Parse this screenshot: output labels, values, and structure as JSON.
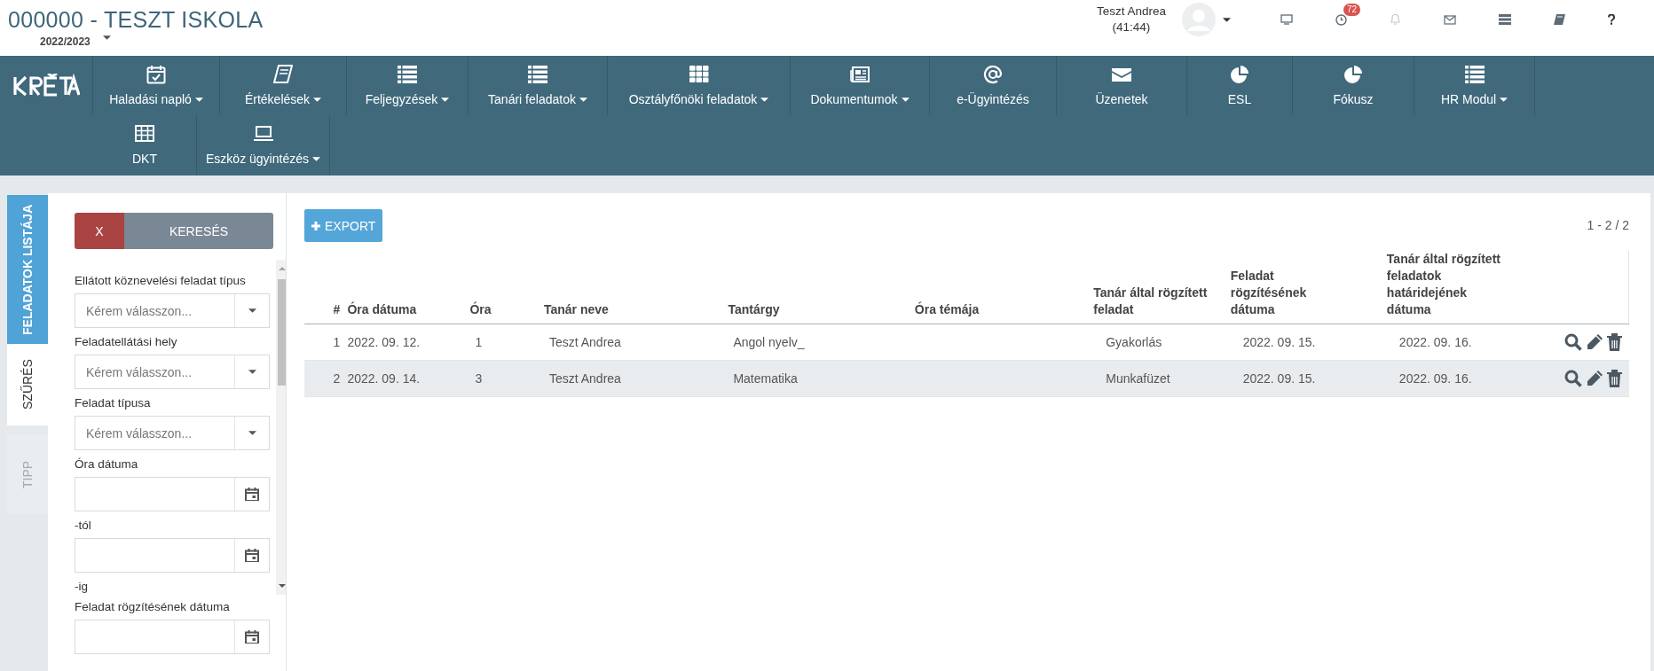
{
  "header": {
    "title": "000000 - TESZT ISKOLA",
    "school_year": "2022/2023",
    "user_name": "Teszt Andrea",
    "session_time": "(41:44)",
    "notification_count": "72"
  },
  "nav": {
    "items": [
      {
        "label": "Haladási napló",
        "has_menu": true
      },
      {
        "label": "Értékelések",
        "has_menu": true
      },
      {
        "label": "Feljegyzések",
        "has_menu": true
      },
      {
        "label": "Tanári feladatok",
        "has_menu": true
      },
      {
        "label": "Osztályfőnöki feladatok",
        "has_menu": true
      },
      {
        "label": "Dokumentumok",
        "has_menu": true
      },
      {
        "label": "e-Ügyintézés",
        "has_menu": false
      },
      {
        "label": "Üzenetek",
        "has_menu": false
      },
      {
        "label": "ESL",
        "has_menu": false
      },
      {
        "label": "Fókusz",
        "has_menu": false
      },
      {
        "label": "HR Modul",
        "has_menu": true
      },
      {
        "label": "DKT",
        "has_menu": false
      },
      {
        "label": "Eszköz ügyintézés",
        "has_menu": true
      }
    ]
  },
  "side_tabs": [
    {
      "label": "FELADATOK LISTÁJA",
      "kind": "accent",
      "selected": false,
      "disabled": false
    },
    {
      "label": "SZŰRÉS",
      "kind": "plain",
      "selected": true,
      "disabled": false
    },
    {
      "label": "TIPP",
      "kind": "plain",
      "selected": false,
      "disabled": true
    }
  ],
  "filter": {
    "clear_button": "X",
    "search_button": "KERESÉS",
    "fields": [
      {
        "kind": "select",
        "label": "Ellátott köznevelési feladat típus",
        "placeholder": "Kérem válasszon..."
      },
      {
        "kind": "select",
        "label": "Feladatellátási hely",
        "placeholder": "Kérem válasszon..."
      },
      {
        "kind": "select",
        "label": "Feladat típusa",
        "placeholder": "Kérem válasszon..."
      },
      {
        "kind": "date",
        "label": "Óra dátuma"
      },
      {
        "kind": "date",
        "label": "-tól"
      },
      {
        "kind": "note",
        "label": "-ig"
      },
      {
        "kind": "date",
        "label": "Feladat rögzítésének dátuma"
      }
    ]
  },
  "main": {
    "export_button": "EXPORT",
    "pager": "1 - 2 / 2",
    "table": {
      "columns": [
        "#",
        "Óra dátuma",
        "Óra",
        "Tanár neve",
        "Tantárgy",
        "Óra témája",
        "Tanár által rögzített feladat",
        "Feladat rögzítésének dátuma",
        "Tanár által rögzített feladatok határidejének dátuma"
      ],
      "rows": [
        {
          "cells": [
            "1",
            "2022. 09. 12.",
            "1",
            "Teszt Andrea",
            "Angol nyelv_",
            "",
            "Gyakorlás",
            "2022. 09. 15.",
            "2022. 09. 16."
          ]
        },
        {
          "cells": [
            "2",
            "2022. 09. 14.",
            "3",
            "Teszt Andrea",
            "Matematika",
            "",
            "Munkafüzet",
            "2022. 09. 15.",
            "2022. 09. 16."
          ]
        }
      ]
    }
  }
}
